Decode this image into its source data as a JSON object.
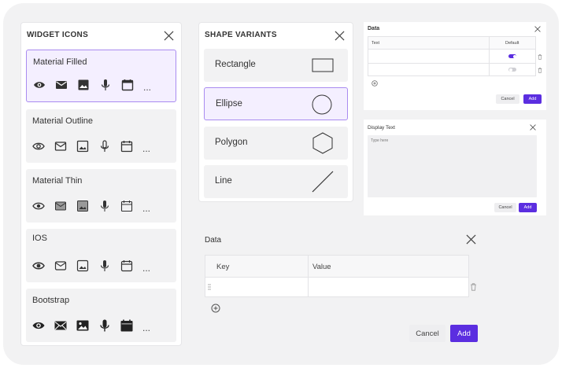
{
  "widget_icons": {
    "title": "WIDGET ICONS",
    "more": "...",
    "cards": [
      {
        "label": "Material Filled",
        "selected": true
      },
      {
        "label": "Material Outline",
        "selected": false
      },
      {
        "label": "Material Thin",
        "selected": false
      },
      {
        "label": "IOS",
        "selected": false
      },
      {
        "label": "Bootstrap",
        "selected": false
      }
    ]
  },
  "shape_variants": {
    "title": "SHAPE VARIANTS",
    "items": [
      {
        "label": "Rectangle",
        "selected": false
      },
      {
        "label": "Ellipse",
        "selected": true
      },
      {
        "label": "Polygon",
        "selected": false
      },
      {
        "label": "Line",
        "selected": false
      }
    ]
  },
  "data_small": {
    "title": "Data",
    "col_text": "Text",
    "col_default": "Default",
    "rows": [
      {
        "default_on": true
      },
      {
        "default_on": false
      }
    ],
    "cancel": "Cancel",
    "add": "Add"
  },
  "display_text": {
    "title": "Display Text",
    "placeholder": "Type here",
    "cancel": "Cancel",
    "add": "Add"
  },
  "data_large": {
    "title": "Data",
    "col_key": "Key",
    "col_value": "Value",
    "cancel": "Cancel",
    "add": "Add"
  },
  "colors": {
    "accent": "#5b2ee0",
    "selected_bg": "#f4efff",
    "selected_border": "#a98bf0",
    "card_bg": "#f2f2f3"
  }
}
